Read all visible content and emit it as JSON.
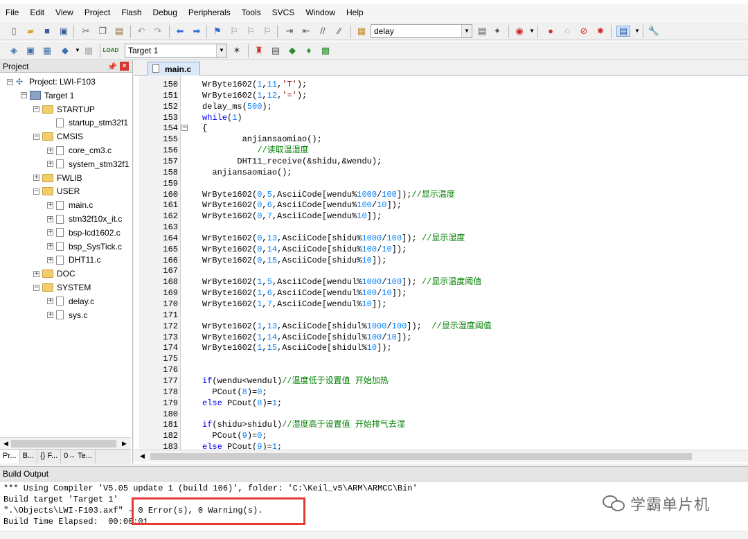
{
  "menu": [
    "File",
    "Edit",
    "View",
    "Project",
    "Flash",
    "Debug",
    "Peripherals",
    "Tools",
    "SVCS",
    "Window",
    "Help"
  ],
  "toolbar1": {
    "search_combo": "delay"
  },
  "toolbar2": {
    "target_combo": "Target 1"
  },
  "project_panel": {
    "title": "Project",
    "tree": [
      {
        "label": "Project: LWI-F103",
        "level": 0,
        "kind": "project",
        "expander": "−"
      },
      {
        "label": "Target 1",
        "level": 1,
        "kind": "target",
        "expander": "−"
      },
      {
        "label": "STARTUP",
        "level": 2,
        "kind": "folder",
        "expander": "−"
      },
      {
        "label": "startup_stm32f1",
        "level": 3,
        "kind": "file",
        "expander": ""
      },
      {
        "label": "CMSIS",
        "level": 2,
        "kind": "folder",
        "expander": "−"
      },
      {
        "label": "core_cm3.c",
        "level": 3,
        "kind": "file",
        "expander": "+"
      },
      {
        "label": "system_stm32f1",
        "level": 3,
        "kind": "file",
        "expander": "+"
      },
      {
        "label": "FWLIB",
        "level": 2,
        "kind": "folder",
        "expander": "+"
      },
      {
        "label": "USER",
        "level": 2,
        "kind": "folder",
        "expander": "−"
      },
      {
        "label": "main.c",
        "level": 3,
        "kind": "file",
        "expander": "+"
      },
      {
        "label": "stm32f10x_it.c",
        "level": 3,
        "kind": "file",
        "expander": "+"
      },
      {
        "label": "bsp-lcd1602.c",
        "level": 3,
        "kind": "file",
        "expander": "+"
      },
      {
        "label": "bsp_SysTick.c",
        "level": 3,
        "kind": "file",
        "expander": "+"
      },
      {
        "label": "DHT11.c",
        "level": 3,
        "kind": "file",
        "expander": "+"
      },
      {
        "label": "DOC",
        "level": 2,
        "kind": "folder",
        "expander": "+"
      },
      {
        "label": "SYSTEM",
        "level": 2,
        "kind": "folder",
        "expander": "−"
      },
      {
        "label": "delay.c",
        "level": 3,
        "kind": "file",
        "expander": "+"
      },
      {
        "label": "sys.c",
        "level": 3,
        "kind": "file",
        "expander": "+"
      }
    ],
    "tabs": [
      "Pr...",
      "B...",
      "{} F...",
      "0→ Te..."
    ]
  },
  "editor": {
    "tab_label": "main.c",
    "lines": [
      {
        "no": "150",
        "fold": "",
        "tokens": [
          [
            "p",
            "WrByte1602("
          ],
          [
            "n",
            "1"
          ],
          [
            "p",
            ","
          ],
          [
            "n",
            "11"
          ],
          [
            "p",
            ","
          ],
          [
            "s",
            "'T'"
          ],
          [
            "p",
            ");"
          ]
        ]
      },
      {
        "no": "151",
        "fold": "",
        "tokens": [
          [
            "p",
            "WrByte1602("
          ],
          [
            "n",
            "1"
          ],
          [
            "p",
            ","
          ],
          [
            "n",
            "12"
          ],
          [
            "p",
            ","
          ],
          [
            "s",
            "'='"
          ],
          [
            "p",
            ");"
          ]
        ]
      },
      {
        "no": "152",
        "fold": "",
        "tokens": [
          [
            "p",
            "delay_ms("
          ],
          [
            "n",
            "500"
          ],
          [
            "p",
            ");"
          ]
        ]
      },
      {
        "no": "153",
        "fold": "",
        "tokens": [
          [
            "k",
            "while"
          ],
          [
            "p",
            "("
          ],
          [
            "n",
            "1"
          ],
          [
            "p",
            ")"
          ]
        ]
      },
      {
        "no": "154",
        "fold": "−",
        "tokens": [
          [
            "p",
            "{"
          ]
        ]
      },
      {
        "no": "155",
        "fold": "",
        "tokens": [
          [
            "p",
            "        anjiansaomiao();"
          ]
        ]
      },
      {
        "no": "156",
        "fold": "",
        "tokens": [
          [
            "c",
            "           //读取温湿度"
          ]
        ]
      },
      {
        "no": "157",
        "fold": "",
        "tokens": [
          [
            "p",
            "       DHT11_receive(&shidu,&wendu);"
          ]
        ]
      },
      {
        "no": "158",
        "fold": "",
        "tokens": [
          [
            "p",
            "  anjiansaomiao();"
          ]
        ]
      },
      {
        "no": "159",
        "fold": "",
        "tokens": []
      },
      {
        "no": "160",
        "fold": "",
        "tokens": [
          [
            "p",
            "WrByte1602("
          ],
          [
            "n",
            "0"
          ],
          [
            "p",
            ","
          ],
          [
            "n",
            "5"
          ],
          [
            "p",
            ",AsciiCode[wendu%"
          ],
          [
            "n",
            "1000"
          ],
          [
            "p",
            "/"
          ],
          [
            "n",
            "100"
          ],
          [
            "p",
            "]);"
          ],
          [
            "c",
            "//显示温度"
          ]
        ]
      },
      {
        "no": "161",
        "fold": "",
        "tokens": [
          [
            "p",
            "WrByte1602("
          ],
          [
            "n",
            "0"
          ],
          [
            "p",
            ","
          ],
          [
            "n",
            "6"
          ],
          [
            "p",
            ",AsciiCode[wendu%"
          ],
          [
            "n",
            "100"
          ],
          [
            "p",
            "/"
          ],
          [
            "n",
            "10"
          ],
          [
            "p",
            "]);"
          ]
        ]
      },
      {
        "no": "162",
        "fold": "",
        "tokens": [
          [
            "p",
            "WrByte1602("
          ],
          [
            "n",
            "0"
          ],
          [
            "p",
            ","
          ],
          [
            "n",
            "7"
          ],
          [
            "p",
            ",AsciiCode[wendu%"
          ],
          [
            "n",
            "10"
          ],
          [
            "p",
            "]);"
          ]
        ]
      },
      {
        "no": "163",
        "fold": "",
        "tokens": []
      },
      {
        "no": "164",
        "fold": "",
        "tokens": [
          [
            "p",
            "WrByte1602("
          ],
          [
            "n",
            "0"
          ],
          [
            "p",
            ","
          ],
          [
            "n",
            "13"
          ],
          [
            "p",
            ",AsciiCode[shidu%"
          ],
          [
            "n",
            "1000"
          ],
          [
            "p",
            "/"
          ],
          [
            "n",
            "100"
          ],
          [
            "p",
            "]); "
          ],
          [
            "c",
            "//显示湿度"
          ]
        ]
      },
      {
        "no": "165",
        "fold": "",
        "tokens": [
          [
            "p",
            "WrByte1602("
          ],
          [
            "n",
            "0"
          ],
          [
            "p",
            ","
          ],
          [
            "n",
            "14"
          ],
          [
            "p",
            ",AsciiCode[shidu%"
          ],
          [
            "n",
            "100"
          ],
          [
            "p",
            "/"
          ],
          [
            "n",
            "10"
          ],
          [
            "p",
            "]);"
          ]
        ]
      },
      {
        "no": "166",
        "fold": "",
        "tokens": [
          [
            "p",
            "WrByte1602("
          ],
          [
            "n",
            "0"
          ],
          [
            "p",
            ","
          ],
          [
            "n",
            "15"
          ],
          [
            "p",
            ",AsciiCode[shidu%"
          ],
          [
            "n",
            "10"
          ],
          [
            "p",
            "]);"
          ]
        ]
      },
      {
        "no": "167",
        "fold": "",
        "tokens": []
      },
      {
        "no": "168",
        "fold": "",
        "tokens": [
          [
            "p",
            "WrByte1602("
          ],
          [
            "n",
            "1"
          ],
          [
            "p",
            ","
          ],
          [
            "n",
            "5"
          ],
          [
            "p",
            ",AsciiCode[wendul%"
          ],
          [
            "n",
            "1000"
          ],
          [
            "p",
            "/"
          ],
          [
            "n",
            "100"
          ],
          [
            "p",
            "]); "
          ],
          [
            "c",
            "//显示温度阈值"
          ]
        ]
      },
      {
        "no": "169",
        "fold": "",
        "tokens": [
          [
            "p",
            "WrByte1602("
          ],
          [
            "n",
            "1"
          ],
          [
            "p",
            ","
          ],
          [
            "n",
            "6"
          ],
          [
            "p",
            ",AsciiCode[wendul%"
          ],
          [
            "n",
            "100"
          ],
          [
            "p",
            "/"
          ],
          [
            "n",
            "10"
          ],
          [
            "p",
            "]);"
          ]
        ]
      },
      {
        "no": "170",
        "fold": "",
        "tokens": [
          [
            "p",
            "WrByte1602("
          ],
          [
            "n",
            "1"
          ],
          [
            "p",
            ","
          ],
          [
            "n",
            "7"
          ],
          [
            "p",
            ",AsciiCode[wendul%"
          ],
          [
            "n",
            "10"
          ],
          [
            "p",
            "]);"
          ]
        ]
      },
      {
        "no": "171",
        "fold": "",
        "tokens": []
      },
      {
        "no": "172",
        "fold": "",
        "tokens": [
          [
            "p",
            "WrByte1602("
          ],
          [
            "n",
            "1"
          ],
          [
            "p",
            ","
          ],
          [
            "n",
            "13"
          ],
          [
            "p",
            ",AsciiCode[shidul%"
          ],
          [
            "n",
            "1000"
          ],
          [
            "p",
            "/"
          ],
          [
            "n",
            "100"
          ],
          [
            "p",
            "]);  "
          ],
          [
            "c",
            "//显示湿度阈值"
          ]
        ]
      },
      {
        "no": "173",
        "fold": "",
        "tokens": [
          [
            "p",
            "WrByte1602("
          ],
          [
            "n",
            "1"
          ],
          [
            "p",
            ","
          ],
          [
            "n",
            "14"
          ],
          [
            "p",
            ",AsciiCode[shidul%"
          ],
          [
            "n",
            "100"
          ],
          [
            "p",
            "/"
          ],
          [
            "n",
            "10"
          ],
          [
            "p",
            "]);"
          ]
        ]
      },
      {
        "no": "174",
        "fold": "",
        "tokens": [
          [
            "p",
            "WrByte1602("
          ],
          [
            "n",
            "1"
          ],
          [
            "p",
            ","
          ],
          [
            "n",
            "15"
          ],
          [
            "p",
            ",AsciiCode[shidul%"
          ],
          [
            "n",
            "10"
          ],
          [
            "p",
            "]);"
          ]
        ]
      },
      {
        "no": "175",
        "fold": "",
        "tokens": []
      },
      {
        "no": "176",
        "fold": "",
        "tokens": []
      },
      {
        "no": "177",
        "fold": "",
        "tokens": [
          [
            "k",
            "if"
          ],
          [
            "p",
            "(wendu<wendul)"
          ],
          [
            "c",
            "//温度低于设置值 开始加热"
          ]
        ]
      },
      {
        "no": "178",
        "fold": "",
        "tokens": [
          [
            "p",
            "  PCout("
          ],
          [
            "n",
            "8"
          ],
          [
            "p",
            ")="
          ],
          [
            "n",
            "0"
          ],
          [
            "p",
            ";"
          ]
        ]
      },
      {
        "no": "179",
        "fold": "",
        "tokens": [
          [
            "k",
            "else"
          ],
          [
            "p",
            " PCout("
          ],
          [
            "n",
            "8"
          ],
          [
            "p",
            ")="
          ],
          [
            "n",
            "1"
          ],
          [
            "p",
            ";"
          ]
        ]
      },
      {
        "no": "180",
        "fold": "",
        "tokens": []
      },
      {
        "no": "181",
        "fold": "",
        "tokens": [
          [
            "k",
            "if"
          ],
          [
            "p",
            "(shidu>shidul)"
          ],
          [
            "c",
            "//湿度高于设置值 开始排气去湿"
          ]
        ]
      },
      {
        "no": "182",
        "fold": "",
        "tokens": [
          [
            "p",
            "  PCout("
          ],
          [
            "n",
            "9"
          ],
          [
            "p",
            ")="
          ],
          [
            "n",
            "0"
          ],
          [
            "p",
            ";"
          ]
        ]
      },
      {
        "no": "183",
        "fold": "",
        "tokens": [
          [
            "k",
            "else"
          ],
          [
            "p",
            " PCout("
          ],
          [
            "n",
            "9"
          ],
          [
            "p",
            ")="
          ],
          [
            "n",
            "1"
          ],
          [
            "p",
            ";"
          ]
        ]
      }
    ]
  },
  "build_output": {
    "title": "Build Output",
    "lines": [
      "*** Using Compiler 'V5.05 update 1 (build 106)', folder: 'C:\\Keil_v5\\ARM\\ARMCC\\Bin'",
      "Build target 'Target 1'",
      "\".\\Objects\\LWI-F103.axf\" - 0 Error(s), 0 Warning(s).",
      "Build Time Elapsed:  00:00:01"
    ]
  },
  "watermark": {
    "text": "学霸单片机"
  },
  "colors": {
    "keyword": "#0000ff",
    "number": "#0080ff",
    "string": "#800000",
    "comment": "#008000",
    "highlight": "#e53935"
  }
}
